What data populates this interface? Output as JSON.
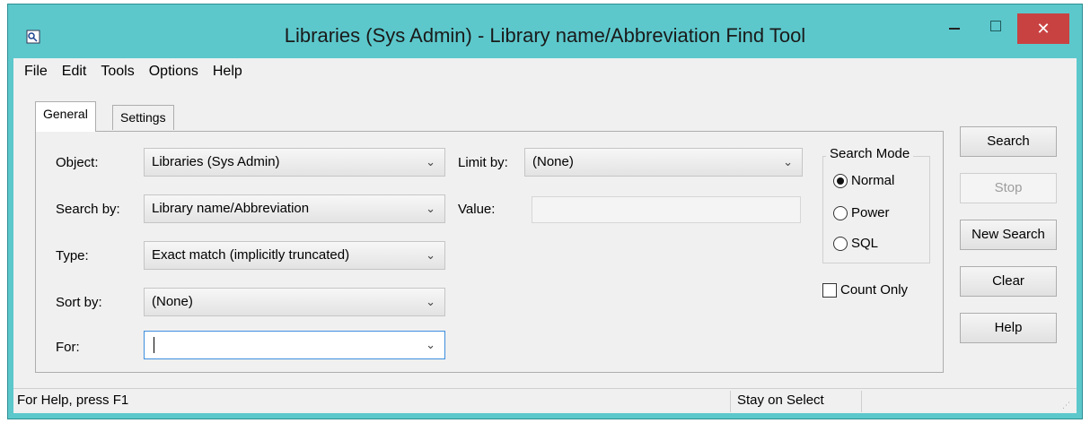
{
  "window": {
    "title": "Libraries (Sys Admin) - Library name/Abbreviation Find Tool",
    "caption": {
      "minimize": "–",
      "maximize": "□",
      "close": "✕"
    }
  },
  "menu": [
    "File",
    "Edit",
    "Tools",
    "Options",
    "Help"
  ],
  "tabs": [
    {
      "label": "General",
      "active": true
    },
    {
      "label": "Settings",
      "active": false
    }
  ],
  "form": {
    "object": {
      "label": "Object:",
      "value": "Libraries (Sys Admin)"
    },
    "search_by": {
      "label": "Search by:",
      "value": "Library name/Abbreviation"
    },
    "type": {
      "label": "Type:",
      "value": "Exact match (implicitly truncated)"
    },
    "sort_by": {
      "label": "Sort by:",
      "value": "(None)"
    },
    "for": {
      "label": "For:",
      "value": ""
    },
    "limit_by": {
      "label": "Limit by:",
      "value": "(None)"
    },
    "value": {
      "label": "Value:",
      "value": ""
    },
    "chevron": "⌄"
  },
  "search_mode": {
    "title": "Search Mode",
    "options": [
      "Normal",
      "Power",
      "SQL"
    ],
    "selected": "Normal"
  },
  "count_only": {
    "label": "Count Only",
    "checked": false
  },
  "buttons": {
    "search": "Search",
    "stop": "Stop",
    "new_search": "New Search",
    "clear": "Clear",
    "help": "Help"
  },
  "status": {
    "left": "For Help, press F1",
    "right": "Stay on Select"
  },
  "colors": {
    "window_frame": "#5cc8cc",
    "close_button": "#c94242"
  }
}
